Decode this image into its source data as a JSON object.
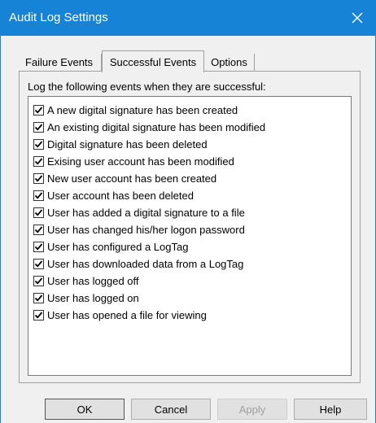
{
  "window": {
    "title": "Audit Log Settings"
  },
  "tabs": [
    {
      "label": "Failure Events",
      "active": false
    },
    {
      "label": "Successful Events",
      "active": true
    },
    {
      "label": "Options",
      "active": false
    }
  ],
  "panel": {
    "caption": "Log the following events when they are successful:",
    "events": [
      {
        "label": "A new digital signature has been created",
        "checked": true
      },
      {
        "label": "An existing digital signature has been modified",
        "checked": true
      },
      {
        "label": "Digital signature has been deleted",
        "checked": true
      },
      {
        "label": "Exising user account has been modified",
        "checked": true
      },
      {
        "label": "New user account has been created",
        "checked": true
      },
      {
        "label": "User account has been deleted",
        "checked": true
      },
      {
        "label": "User has added a digital signature to a file",
        "checked": true
      },
      {
        "label": "User has changed his/her logon password",
        "checked": true
      },
      {
        "label": "User has configured a LogTag",
        "checked": true
      },
      {
        "label": "User has downloaded data from a LogTag",
        "checked": true
      },
      {
        "label": "User has logged off",
        "checked": true
      },
      {
        "label": "User has logged on",
        "checked": true
      },
      {
        "label": "User has opened a file for viewing",
        "checked": true
      }
    ]
  },
  "buttons": {
    "ok": "OK",
    "cancel": "Cancel",
    "apply": "Apply",
    "help": "Help"
  },
  "colors": {
    "titlebar": "#1783d6",
    "face": "#f0f0f0"
  }
}
